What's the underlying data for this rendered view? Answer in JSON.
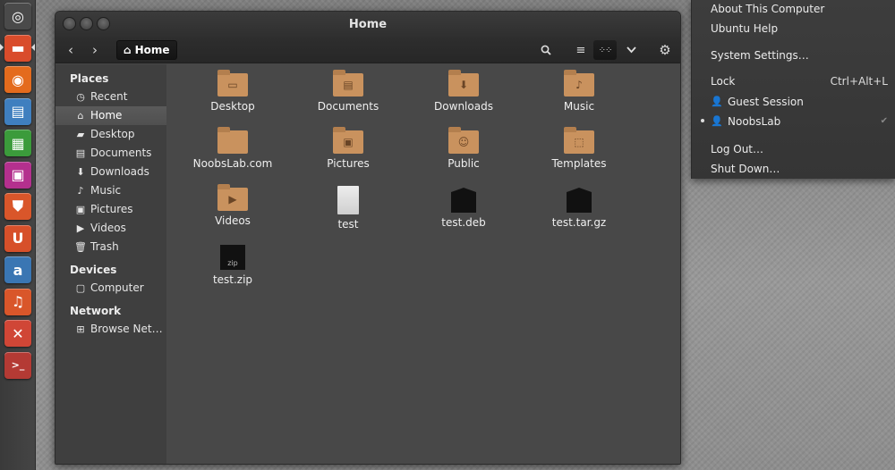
{
  "launcher": {
    "items": [
      {
        "icon": "dash-icon",
        "color": "#4a4a4a",
        "glyph": "◎"
      },
      {
        "icon": "files-icon",
        "color": "#d94c2b",
        "glyph": "▬"
      },
      {
        "icon": "firefox-icon",
        "color": "#e46b1d",
        "glyph": "◉"
      },
      {
        "icon": "writer-icon",
        "color": "#3f7fbf",
        "glyph": "▤"
      },
      {
        "icon": "calc-icon",
        "color": "#3b9b3b",
        "glyph": "▦"
      },
      {
        "icon": "impress-icon",
        "color": "#b4308e",
        "glyph": "▣"
      },
      {
        "icon": "software-center-icon",
        "color": "#d9562a",
        "glyph": "⛊"
      },
      {
        "icon": "ubuntu-one-icon",
        "color": "#d7502a",
        "glyph": "U"
      },
      {
        "icon": "amazon-icon",
        "color": "#3a76b3",
        "glyph": "a"
      },
      {
        "icon": "music-icon",
        "color": "#d9562a",
        "glyph": "♫"
      },
      {
        "icon": "tools-icon",
        "color": "#d04636",
        "glyph": "✕"
      },
      {
        "icon": "terminal-icon",
        "color": "#b43a34",
        "glyph": ">_"
      }
    ]
  },
  "window": {
    "title": "Home",
    "path_label": "Home"
  },
  "sidebar": {
    "places_heading": "Places",
    "places": [
      {
        "label": "Recent",
        "icon": "recent-icon",
        "glyph": "◷"
      },
      {
        "label": "Home",
        "icon": "home-icon",
        "glyph": "⌂",
        "active": true
      },
      {
        "label": "Desktop",
        "icon": "desktop-folder-icon",
        "glyph": "▰"
      },
      {
        "label": "Documents",
        "icon": "documents-icon",
        "glyph": "▤"
      },
      {
        "label": "Downloads",
        "icon": "downloads-icon",
        "glyph": "⬇"
      },
      {
        "label": "Music",
        "icon": "music-note-icon",
        "glyph": "♪"
      },
      {
        "label": "Pictures",
        "icon": "pictures-icon",
        "glyph": "▣"
      },
      {
        "label": "Videos",
        "icon": "videos-icon",
        "glyph": "▶"
      },
      {
        "label": "Trash",
        "icon": "trash-icon",
        "glyph": "🗑"
      }
    ],
    "devices_heading": "Devices",
    "devices": [
      {
        "label": "Computer",
        "icon": "computer-icon",
        "glyph": "▢"
      }
    ],
    "network_heading": "Network",
    "network": [
      {
        "label": "Browse Net…",
        "icon": "network-icon",
        "glyph": "⊞"
      }
    ]
  },
  "files": [
    {
      "label": "Desktop",
      "kind": "folder",
      "icon": "desktop-folder-icon",
      "glyph": "▭"
    },
    {
      "label": "Documents",
      "kind": "folder",
      "icon": "documents-folder-icon",
      "glyph": "▤"
    },
    {
      "label": "Downloads",
      "kind": "folder",
      "icon": "downloads-folder-icon",
      "glyph": "⬇"
    },
    {
      "label": "Music",
      "kind": "folder",
      "icon": "music-folder-icon",
      "glyph": "♪"
    },
    {
      "label": "NoobsLab.com",
      "kind": "folder",
      "icon": "folder-icon",
      "glyph": ""
    },
    {
      "label": "Pictures",
      "kind": "folder",
      "icon": "pictures-folder-icon",
      "glyph": "▣"
    },
    {
      "label": "Public",
      "kind": "folder",
      "icon": "public-folder-icon",
      "glyph": "☺"
    },
    {
      "label": "Templates",
      "kind": "folder",
      "icon": "templates-folder-icon",
      "glyph": "⬚"
    },
    {
      "label": "Videos",
      "kind": "folder",
      "icon": "videos-folder-icon",
      "glyph": "▶"
    },
    {
      "label": "test",
      "kind": "doc",
      "icon": "text-file-icon"
    },
    {
      "label": "test.deb",
      "kind": "pkg",
      "icon": "deb-package-icon"
    },
    {
      "label": "test.tar.gz",
      "kind": "pkg",
      "icon": "archive-icon"
    },
    {
      "label": "test.zip",
      "kind": "zip",
      "icon": "zip-archive-icon",
      "badge": "zip"
    }
  ],
  "session_menu": {
    "about": "About This Computer",
    "help": "Ubuntu Help",
    "settings": "System Settings…",
    "lock": "Lock",
    "lock_shortcut": "Ctrl+Alt+L",
    "guest": "Guest Session",
    "user": "NoobsLab",
    "logout": "Log Out…",
    "shutdown": "Shut Down…"
  }
}
